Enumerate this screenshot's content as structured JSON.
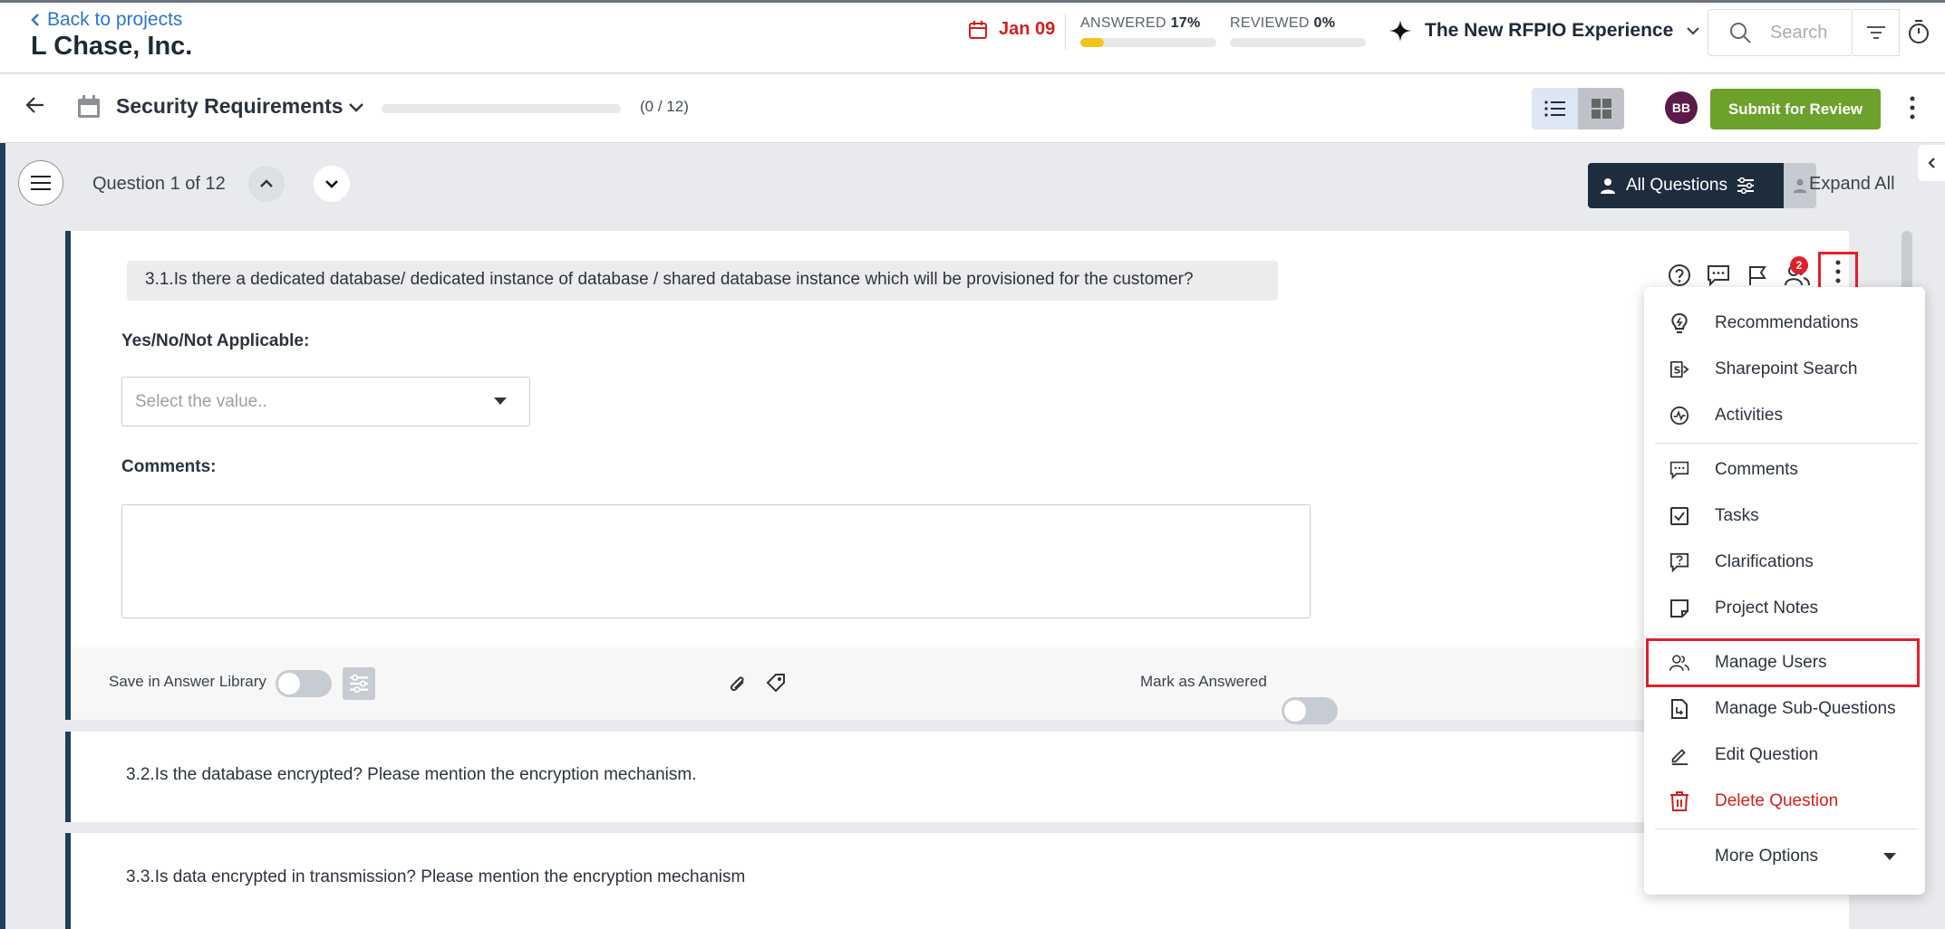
{
  "header": {
    "back_label": "Back to projects",
    "company": "L Chase, Inc.",
    "due_date": "Jan 09",
    "answered_label": "ANSWERED",
    "answered_pct": "17%",
    "answered_fill": 0.17,
    "reviewed_label": "REVIEWED",
    "reviewed_pct": "0%",
    "reviewed_fill": 0,
    "brand": "The New RFPIO Experience",
    "search_placeholder": "Search"
  },
  "section": {
    "title": "Security Requirements",
    "progress_text": "(0 / 12)",
    "avatar_initials": "BB",
    "submit_label": "Submit for Review"
  },
  "nav": {
    "question_counter": "Question 1 of 12",
    "all_questions_label": "All Questions",
    "expand_all_label": "Expand All"
  },
  "question1": {
    "text": "3.1.Is there a dedicated database/ dedicated instance of database / shared database instance which will be provisioned for the customer?",
    "field_label": "Yes/No/Not Applicable:",
    "select_placeholder": "Select the value..",
    "comments_label": "Comments:",
    "save_library_label": "Save in Answer Library",
    "mark_answered_label": "Mark as Answered",
    "users_badge": "2"
  },
  "question2": {
    "text": "3.2.Is the database encrypted? Please mention the encryption mechanism."
  },
  "question3": {
    "text": "3.3.Is data encrypted in transmission? Please mention the encryption mechanism"
  },
  "menu": {
    "items": [
      {
        "label": "Recommendations",
        "icon": "lightbulb-icon"
      },
      {
        "label": "Sharepoint Search",
        "icon": "sharepoint-icon"
      },
      {
        "label": "Activities",
        "icon": "activity-icon"
      },
      {
        "label": "Comments",
        "icon": "comment-icon"
      },
      {
        "label": "Tasks",
        "icon": "task-check-icon"
      },
      {
        "label": "Clarifications",
        "icon": "clarification-icon"
      },
      {
        "label": "Project Notes",
        "icon": "note-icon"
      },
      {
        "label": "Manage Users",
        "icon": "users-icon"
      },
      {
        "label": "Manage Sub-Questions",
        "icon": "sub-question-icon"
      },
      {
        "label": "Edit Question",
        "icon": "pencil-icon"
      },
      {
        "label": "Delete Question",
        "icon": "trash-icon"
      }
    ],
    "more_options": "More Options"
  },
  "colors": {
    "accent_green": "#6ca12b",
    "danger_red": "#e0202a",
    "navy": "#1d2d3e",
    "progress_yellow": "#f2c417"
  }
}
